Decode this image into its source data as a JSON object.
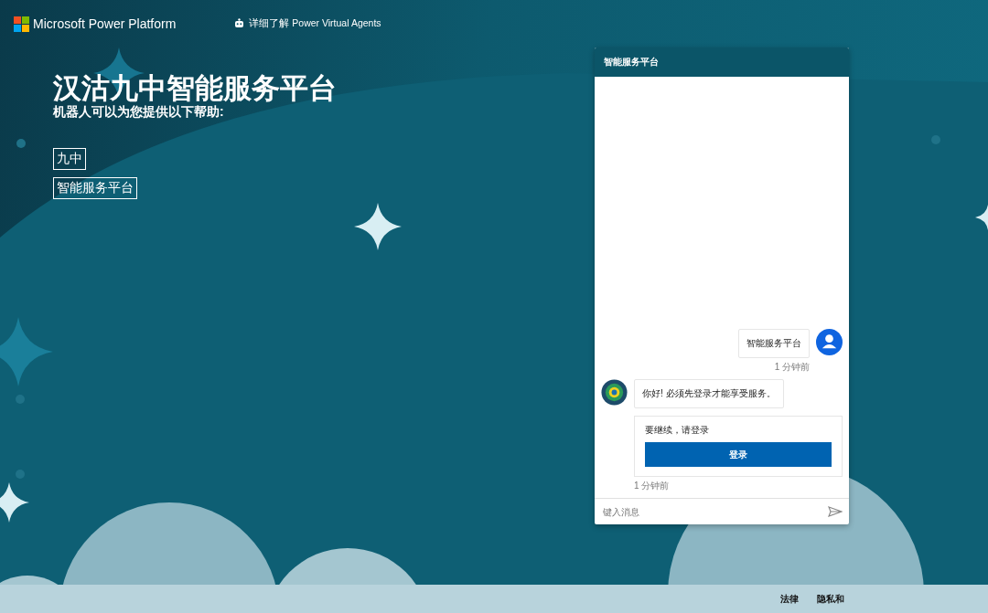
{
  "header": {
    "brand": "Microsoft Power Platform",
    "learn_more_link": "详细了解 Power Virtual Agents"
  },
  "hero": {
    "title": "汉沽九中智能服务平台",
    "subtitle": "机器人可以为您提供以下帮助:",
    "suggestions": [
      "九中",
      "智能服务平台"
    ]
  },
  "chat": {
    "title": "智能服务平台",
    "messages": [
      {
        "kind": "user",
        "text": "智能服务平台",
        "time": "1 分钟前"
      },
      {
        "kind": "bot",
        "text": "你好! 必须先登录才能享受服务。"
      },
      {
        "kind": "signin_card",
        "text": "要继续，请登录",
        "button": "登录",
        "time": "1 分钟前"
      }
    ],
    "input": {
      "placeholder": "键入消息"
    }
  },
  "footer": {
    "links": [
      "法律",
      "隐私和"
    ]
  }
}
